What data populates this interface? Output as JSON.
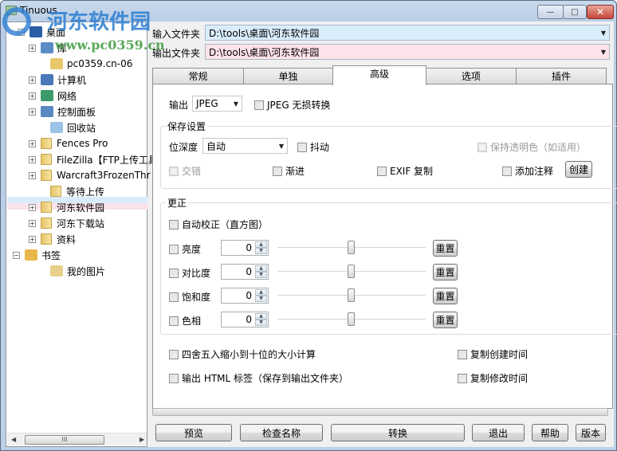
{
  "window": {
    "title": "Tinuous",
    "controls": {
      "minimize": "—",
      "maximize": "□",
      "close": "✕"
    }
  },
  "watermark": {
    "text_top": "河东软件园",
    "text_url": "www.pc0359.cn"
  },
  "tree": {
    "items": [
      {
        "label": "桌面",
        "icon": "desktop-icon",
        "expander": "−"
      },
      {
        "label": "库",
        "icon": "library-icon",
        "expander": "+"
      },
      {
        "label": "pc0359.cn-06",
        "icon": "user-folder-icon",
        "expander": ""
      },
      {
        "label": "计算机",
        "icon": "computer-icon",
        "expander": "+"
      },
      {
        "label": "网络",
        "icon": "network-icon",
        "expander": "+"
      },
      {
        "label": "控制面板",
        "icon": "control-panel-icon",
        "expander": "+"
      },
      {
        "label": "回收站",
        "icon": "recycle-bin-icon",
        "expander": ""
      },
      {
        "label": "Fences Pro",
        "icon": "folder-icon",
        "expander": "+"
      },
      {
        "label": "FileZilla【FTP上传工具",
        "icon": "folder-icon",
        "expander": "+"
      },
      {
        "label": "Warcraft3FrozenThr",
        "icon": "folder-icon",
        "expander": "+"
      },
      {
        "label": "等待上传",
        "icon": "folder-icon",
        "expander": ""
      },
      {
        "label": "河东软件园",
        "icon": "folder-icon",
        "expander": "+",
        "selected": true
      },
      {
        "label": "河东下载站",
        "icon": "folder-icon",
        "expander": "+"
      },
      {
        "label": "资料",
        "icon": "folder-icon",
        "expander": "+"
      },
      {
        "label": "书签",
        "icon": "bookmark-folder-icon",
        "expander": "−"
      },
      {
        "label": "我的图片",
        "icon": "picture-folder-icon",
        "expander": ""
      }
    ],
    "scrollbar": {
      "left_arrow": "◀",
      "right_arrow": "▶",
      "grip": "III"
    }
  },
  "paths": {
    "input_label": "输入文件夹",
    "input_value": "D:\\tools\\桌面\\河东软件园",
    "output_label": "输出文件夹",
    "output_value": "D:\\tools\\桌面\\河东软件园",
    "dropdown_glyph": "▼"
  },
  "tabs": [
    {
      "label": "常规",
      "active": false
    },
    {
      "label": "单独",
      "active": false
    },
    {
      "label": "高级",
      "active": true
    },
    {
      "label": "选项",
      "active": false
    },
    {
      "label": "插件",
      "active": false
    }
  ],
  "advanced": {
    "output_label": "输出",
    "output_format": "JPEG",
    "jpeg_lossless": {
      "label": "JPEG 无损转换",
      "checked": false
    },
    "save_settings": {
      "title": "保存设置",
      "bit_depth_label": "位深度",
      "bit_depth_value": "自动",
      "dither": {
        "label": "抖动",
        "checked": false
      },
      "keep_transparent": {
        "label": "保持透明色（如适用）",
        "checked": false,
        "disabled": true
      },
      "interlace": {
        "label": "交错",
        "checked": false,
        "disabled": true
      },
      "progressive": {
        "label": "渐进",
        "checked": false
      },
      "exif_copy": {
        "label": "EXIF 复制",
        "checked": false
      },
      "add_comment": {
        "label": "添加注释",
        "checked": false
      },
      "create_button": "创建"
    },
    "correction": {
      "title": "更正",
      "auto_correct": {
        "label": "自动校正（直方图）",
        "checked": false
      },
      "rows": [
        {
          "label": "亮度",
          "value": "0",
          "slider_fraction": 0.5,
          "reset": "重置"
        },
        {
          "label": "对比度",
          "value": "0",
          "slider_fraction": 0.5,
          "reset": "重置"
        },
        {
          "label": "饱和度",
          "value": "0",
          "slider_fraction": 0.5,
          "reset": "重置"
        },
        {
          "label": "色相",
          "value": "0",
          "slider_fraction": 0.5,
          "reset": "重置"
        }
      ]
    },
    "round_size": {
      "label": "四舍五入缩小到十位的大小计算",
      "checked": false
    },
    "copy_created": {
      "label": "复制创建时间",
      "checked": false
    },
    "output_html": {
      "label": "输出 HTML 标签（保存到输出文件夹）",
      "checked": false
    },
    "copy_modified": {
      "label": "复制修改时间",
      "checked": false
    }
  },
  "progress": {
    "fraction": 0
  },
  "buttons": {
    "preview": "预览",
    "check_names": "检查名称",
    "convert": "转换",
    "exit": "退出",
    "help": "帮助",
    "version": "版本"
  },
  "colors": {
    "input_field_bg": "#d9edfb",
    "output_field_bg": "#fde3ea",
    "selection_blue": "#d8ecfb",
    "selection_pink": "#fbe2ea",
    "watermark_blue": "#2a7dd1",
    "watermark_green": "#3c9a3c"
  }
}
